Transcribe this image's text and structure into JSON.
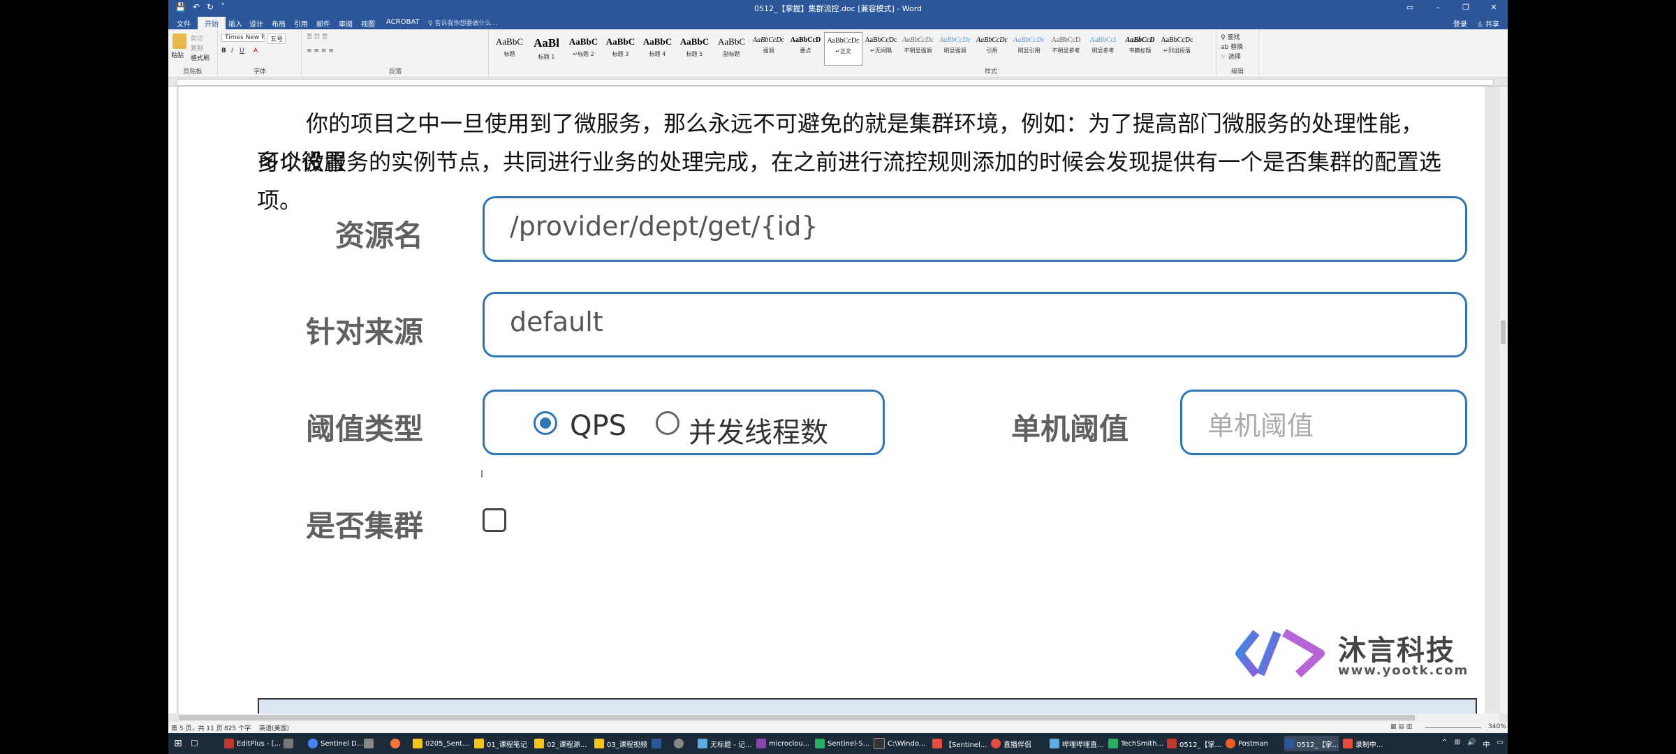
{
  "window": {
    "title": "0512_【掌握】集群流控.doc [兼容模式] - Word",
    "min": "–",
    "max": "❐",
    "close": "✕",
    "restore": "▭"
  },
  "qat": [
    "💾",
    "↶",
    "↻",
    "˅"
  ],
  "tabs": [
    "文件",
    "开始",
    "插入",
    "设计",
    "布局",
    "引用",
    "邮件",
    "审阅",
    "视图",
    "ACROBAT"
  ],
  "tell_me": "♀ 告诉我你想要做什么...",
  "account": {
    "login": "登录",
    "share": "♙ 共享"
  },
  "ribbon": {
    "clipboard": {
      "label": "剪贴板",
      "paste": "粘贴",
      "cut": "剪切",
      "copy": "复制",
      "format": "格式刷"
    },
    "font": {
      "label": "字体",
      "name": "Times New R",
      "size": "五号"
    },
    "paragraph": {
      "label": "段落"
    },
    "styles": {
      "label": "样式",
      "items": [
        {
          "preview": "AaBbC",
          "name": "标题"
        },
        {
          "preview": "AaBl",
          "name": "标题 1"
        },
        {
          "preview": "AaBbC",
          "name": "↵标题 2"
        },
        {
          "preview": "AaBbC",
          "name": "标题 3"
        },
        {
          "preview": "AaBbC",
          "name": "标题 4"
        },
        {
          "preview": "AaBbC",
          "name": "标题 5"
        },
        {
          "preview": "AaBbC",
          "name": "副标题"
        },
        {
          "preview": "AaBbCcDc",
          "name": "强调"
        },
        {
          "preview": "AaBbCcD",
          "name": "要点"
        },
        {
          "preview": "AaBbCcDc",
          "name": "↵正文"
        },
        {
          "preview": "AaBbCcDc",
          "name": "↵无间隔"
        },
        {
          "preview": "AaBbCcDc",
          "name": "不明显强调"
        },
        {
          "preview": "AaBbCcDc",
          "name": "明显强调"
        },
        {
          "preview": "AaBbCcDc",
          "name": "引用"
        },
        {
          "preview": "AaBbCcDc",
          "name": "明显引用"
        },
        {
          "preview": "AaBbCcD",
          "name": "不明显参考"
        },
        {
          "preview": "AaBbCcI",
          "name": "明显参考"
        },
        {
          "preview": "AaBbCcD",
          "name": "书籍标题"
        },
        {
          "preview": "AaBbCcDc",
          "name": "↵列出段落"
        }
      ]
    },
    "editing": {
      "label": "编辑",
      "find": "♀ 查找",
      "replace": "ab 替换",
      "select": "☞ 选择"
    }
  },
  "document": {
    "paragraph_line1": "你的项目之中一旦使用到了微服务，那么永远不可避免的就是集群环境，例如：为了提高部门微服务的处理性能，可以设置",
    "paragraph_line2": "多个微服务的实例节点，共同进行业务的处理完成，在之前进行流控规则添加的时候会发现提供有一个是否集群的配置选项。",
    "form": {
      "resource_label": "资源名",
      "resource_value": "/provider/dept/get/{id}",
      "source_label": "针对来源",
      "source_value": "default",
      "threshold_type_label": "阈值类型",
      "option_qps": "QPS",
      "option_threads": "并发线程数",
      "selected": "QPS",
      "single_threshold_label": "单机阈值",
      "single_threshold_placeholder": "单机阈值",
      "cluster_label": "是否集群",
      "cluster_checked": false
    },
    "logo": {
      "name": "沐言科技",
      "url": "www.yootk.com"
    }
  },
  "status": {
    "page": "第 5 页，共 11 页",
    "words": "825 个字",
    "lang": "英语(美国)",
    "zoom": "340%"
  },
  "taskbar": [
    {
      "label": "EditPlus - [...",
      "color": "#c0392b"
    },
    {
      "label": "Sentinel D...",
      "color": "#4285f4"
    },
    {
      "label": "",
      "color": "#777"
    },
    {
      "label": "",
      "color": "#ff7139"
    },
    {
      "label": "0205_Sent...",
      "color": "#f5c518"
    },
    {
      "label": "01_课程笔记",
      "color": "#f5c518"
    },
    {
      "label": "02_课程源...",
      "color": "#f5c518"
    },
    {
      "label": "03_课程视频",
      "color": "#f5c518"
    },
    {
      "label": "",
      "color": "#2b579a"
    },
    {
      "label": "",
      "color": "#888"
    },
    {
      "label": "无标题 - 记...",
      "color": "#5dade2"
    },
    {
      "label": "microclou...",
      "color": "#8e44ad"
    },
    {
      "label": "Sentinel-S...",
      "color": "#27ae60"
    },
    {
      "label": "C:\\Windo...",
      "color": "#333"
    },
    {
      "label": "【Sentinel...",
      "color": "#e74c3c"
    },
    {
      "label": "直播伴侣",
      "color": "#e74c3c"
    },
    {
      "label": "哔哩哔哩直...",
      "color": "#5dade2"
    },
    {
      "label": "TechSmith...",
      "color": "#27ae60"
    },
    {
      "label": "0512_【掌...",
      "color": "#c0392b"
    },
    {
      "label": "Postman",
      "color": "#ef5b25"
    },
    {
      "label": "0512_【掌...",
      "color": "#2b579a"
    },
    {
      "label": "录制中...",
      "color": "#e74c3c"
    }
  ],
  "tray": [
    "^",
    "⊞",
    "🔊",
    "中",
    "▭"
  ]
}
